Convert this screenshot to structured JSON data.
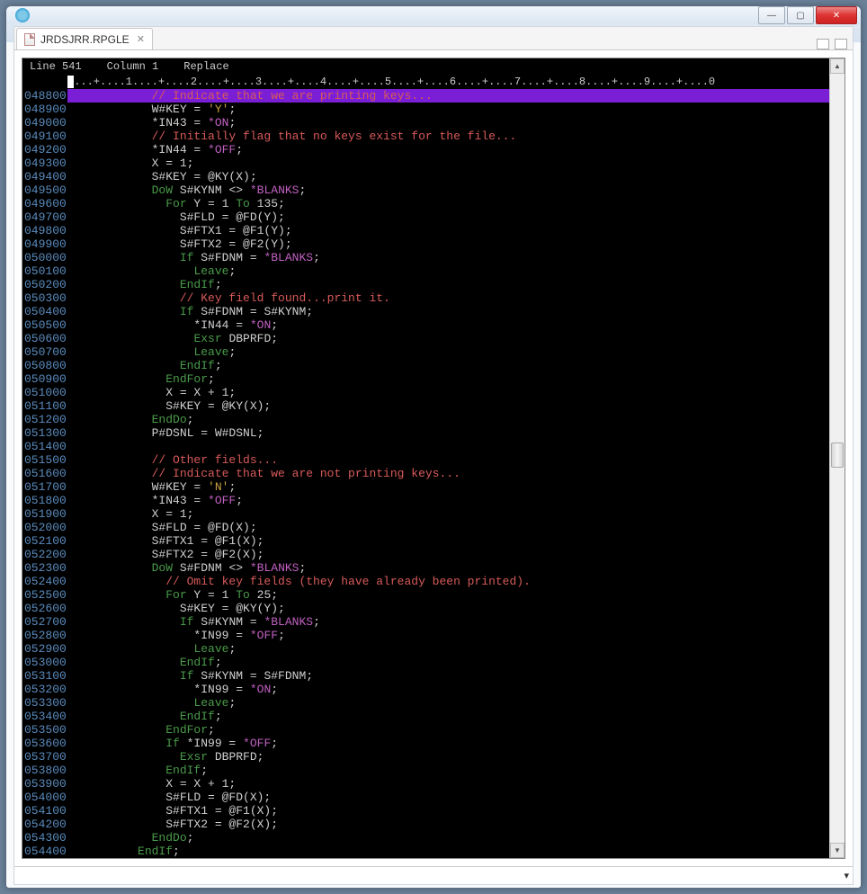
{
  "window": {
    "title": ""
  },
  "tab": {
    "filename": "JRDSJRR.RPGLE"
  },
  "status": {
    "line_label": "Line",
    "line": "541",
    "col_label": "Column",
    "col": "1",
    "mode": "Replace"
  },
  "ruler": "....+....1....+....2....+....3....+....4....+....5....+....6....+....7....+....8....+....9....+....0",
  "lines": [
    {
      "n": "048800",
      "seg": [
        {
          "c": "c-comment",
          "t": "            // Indicate that we are printing keys..."
        }
      ],
      "hl": true
    },
    {
      "n": "048900",
      "seg": [
        {
          "c": "c-plain",
          "t": "            W#KEY = "
        },
        {
          "c": "c-str",
          "t": "'Y'"
        },
        {
          "c": "c-plain",
          "t": ";"
        }
      ]
    },
    {
      "n": "049000",
      "seg": [
        {
          "c": "c-plain",
          "t": "            *IN43 = "
        },
        {
          "c": "c-special",
          "t": "*ON"
        },
        {
          "c": "c-plain",
          "t": ";"
        }
      ]
    },
    {
      "n": "049100",
      "seg": [
        {
          "c": "c-comment",
          "t": "            // Initially flag that no keys exist for the file..."
        }
      ]
    },
    {
      "n": "049200",
      "seg": [
        {
          "c": "c-plain",
          "t": "            *IN44 = "
        },
        {
          "c": "c-special",
          "t": "*OFF"
        },
        {
          "c": "c-plain",
          "t": ";"
        }
      ]
    },
    {
      "n": "049300",
      "seg": [
        {
          "c": "c-plain",
          "t": "            X = 1;"
        }
      ]
    },
    {
      "n": "049400",
      "seg": [
        {
          "c": "c-plain",
          "t": "            S#KEY = @KY(X);"
        }
      ]
    },
    {
      "n": "049500",
      "seg": [
        {
          "c": "c-plain",
          "t": "            "
        },
        {
          "c": "c-kw",
          "t": "DoW"
        },
        {
          "c": "c-plain",
          "t": " S#KYNM <> "
        },
        {
          "c": "c-special",
          "t": "*BLANKS"
        },
        {
          "c": "c-plain",
          "t": ";"
        }
      ]
    },
    {
      "n": "049600",
      "seg": [
        {
          "c": "c-plain",
          "t": "              "
        },
        {
          "c": "c-kw",
          "t": "For"
        },
        {
          "c": "c-plain",
          "t": " Y = 1 "
        },
        {
          "c": "c-kw",
          "t": "To"
        },
        {
          "c": "c-plain",
          "t": " 135;"
        }
      ]
    },
    {
      "n": "049700",
      "seg": [
        {
          "c": "c-plain",
          "t": "                S#FLD = @FD(Y);"
        }
      ]
    },
    {
      "n": "049800",
      "seg": [
        {
          "c": "c-plain",
          "t": "                S#FTX1 = @F1(Y);"
        }
      ]
    },
    {
      "n": "049900",
      "seg": [
        {
          "c": "c-plain",
          "t": "                S#FTX2 = @F2(Y);"
        }
      ]
    },
    {
      "n": "050000",
      "seg": [
        {
          "c": "c-plain",
          "t": "                "
        },
        {
          "c": "c-kw",
          "t": "If"
        },
        {
          "c": "c-plain",
          "t": " S#FDNM = "
        },
        {
          "c": "c-special",
          "t": "*BLANKS"
        },
        {
          "c": "c-plain",
          "t": ";"
        }
      ]
    },
    {
      "n": "050100",
      "seg": [
        {
          "c": "c-plain",
          "t": "                  "
        },
        {
          "c": "c-kw",
          "t": "Leave"
        },
        {
          "c": "c-plain",
          "t": ";"
        }
      ]
    },
    {
      "n": "050200",
      "seg": [
        {
          "c": "c-plain",
          "t": "                "
        },
        {
          "c": "c-kw",
          "t": "EndIf"
        },
        {
          "c": "c-plain",
          "t": ";"
        }
      ]
    },
    {
      "n": "050300",
      "seg": [
        {
          "c": "c-comment",
          "t": "                // Key field found...print it."
        }
      ]
    },
    {
      "n": "050400",
      "seg": [
        {
          "c": "c-plain",
          "t": "                "
        },
        {
          "c": "c-kw",
          "t": "If"
        },
        {
          "c": "c-plain",
          "t": " S#FDNM = S#KYNM;"
        }
      ]
    },
    {
      "n": "050500",
      "seg": [
        {
          "c": "c-plain",
          "t": "                  *IN44 = "
        },
        {
          "c": "c-special",
          "t": "*ON"
        },
        {
          "c": "c-plain",
          "t": ";"
        }
      ]
    },
    {
      "n": "050600",
      "seg": [
        {
          "c": "c-plain",
          "t": "                  "
        },
        {
          "c": "c-kw",
          "t": "Exsr"
        },
        {
          "c": "c-plain",
          "t": " DBPRFD;"
        }
      ]
    },
    {
      "n": "050700",
      "seg": [
        {
          "c": "c-plain",
          "t": "                  "
        },
        {
          "c": "c-kw",
          "t": "Leave"
        },
        {
          "c": "c-plain",
          "t": ";"
        }
      ]
    },
    {
      "n": "050800",
      "seg": [
        {
          "c": "c-plain",
          "t": "                "
        },
        {
          "c": "c-kw",
          "t": "EndIf"
        },
        {
          "c": "c-plain",
          "t": ";"
        }
      ]
    },
    {
      "n": "050900",
      "seg": [
        {
          "c": "c-plain",
          "t": "              "
        },
        {
          "c": "c-kw",
          "t": "EndFor"
        },
        {
          "c": "c-plain",
          "t": ";"
        }
      ]
    },
    {
      "n": "051000",
      "seg": [
        {
          "c": "c-plain",
          "t": "              X = X + 1;"
        }
      ]
    },
    {
      "n": "051100",
      "seg": [
        {
          "c": "c-plain",
          "t": "              S#KEY = @KY(X);"
        }
      ]
    },
    {
      "n": "051200",
      "seg": [
        {
          "c": "c-plain",
          "t": "            "
        },
        {
          "c": "c-kw",
          "t": "EndDo"
        },
        {
          "c": "c-plain",
          "t": ";"
        }
      ]
    },
    {
      "n": "051300",
      "seg": [
        {
          "c": "c-plain",
          "t": "            P#DSNL = W#DSNL;"
        }
      ]
    },
    {
      "n": "051400",
      "seg": [
        {
          "c": "c-plain",
          "t": ""
        }
      ]
    },
    {
      "n": "051500",
      "seg": [
        {
          "c": "c-comment",
          "t": "            // Other fields..."
        }
      ]
    },
    {
      "n": "051600",
      "seg": [
        {
          "c": "c-comment",
          "t": "            // Indicate that we are not printing keys..."
        }
      ]
    },
    {
      "n": "051700",
      "seg": [
        {
          "c": "c-plain",
          "t": "            W#KEY = "
        },
        {
          "c": "c-str",
          "t": "'N'"
        },
        {
          "c": "c-plain",
          "t": ";"
        }
      ]
    },
    {
      "n": "051800",
      "seg": [
        {
          "c": "c-plain",
          "t": "            *IN43 = "
        },
        {
          "c": "c-special",
          "t": "*OFF"
        },
        {
          "c": "c-plain",
          "t": ";"
        }
      ]
    },
    {
      "n": "051900",
      "seg": [
        {
          "c": "c-plain",
          "t": "            X = 1;"
        }
      ]
    },
    {
      "n": "052000",
      "seg": [
        {
          "c": "c-plain",
          "t": "            S#FLD = @FD(X);"
        }
      ]
    },
    {
      "n": "052100",
      "seg": [
        {
          "c": "c-plain",
          "t": "            S#FTX1 = @F1(X);"
        }
      ]
    },
    {
      "n": "052200",
      "seg": [
        {
          "c": "c-plain",
          "t": "            S#FTX2 = @F2(X);"
        }
      ]
    },
    {
      "n": "052300",
      "seg": [
        {
          "c": "c-plain",
          "t": "            "
        },
        {
          "c": "c-kw",
          "t": "DoW"
        },
        {
          "c": "c-plain",
          "t": " S#FDNM <> "
        },
        {
          "c": "c-special",
          "t": "*BLANKS"
        },
        {
          "c": "c-plain",
          "t": ";"
        }
      ]
    },
    {
      "n": "052400",
      "seg": [
        {
          "c": "c-comment",
          "t": "              // Omit key fields (they have already been printed)."
        }
      ]
    },
    {
      "n": "052500",
      "seg": [
        {
          "c": "c-plain",
          "t": "              "
        },
        {
          "c": "c-kw",
          "t": "For"
        },
        {
          "c": "c-plain",
          "t": " Y = 1 "
        },
        {
          "c": "c-kw",
          "t": "To"
        },
        {
          "c": "c-plain",
          "t": " 25;"
        }
      ]
    },
    {
      "n": "052600",
      "seg": [
        {
          "c": "c-plain",
          "t": "                S#KEY = @KY(Y);"
        }
      ]
    },
    {
      "n": "052700",
      "seg": [
        {
          "c": "c-plain",
          "t": "                "
        },
        {
          "c": "c-kw",
          "t": "If"
        },
        {
          "c": "c-plain",
          "t": " S#KYNM = "
        },
        {
          "c": "c-special",
          "t": "*BLANKS"
        },
        {
          "c": "c-plain",
          "t": ";"
        }
      ]
    },
    {
      "n": "052800",
      "seg": [
        {
          "c": "c-plain",
          "t": "                  *IN99 = "
        },
        {
          "c": "c-special",
          "t": "*OFF"
        },
        {
          "c": "c-plain",
          "t": ";"
        }
      ]
    },
    {
      "n": "052900",
      "seg": [
        {
          "c": "c-plain",
          "t": "                  "
        },
        {
          "c": "c-kw",
          "t": "Leave"
        },
        {
          "c": "c-plain",
          "t": ";"
        }
      ]
    },
    {
      "n": "053000",
      "seg": [
        {
          "c": "c-plain",
          "t": "                "
        },
        {
          "c": "c-kw",
          "t": "EndIf"
        },
        {
          "c": "c-plain",
          "t": ";"
        }
      ]
    },
    {
      "n": "053100",
      "seg": [
        {
          "c": "c-plain",
          "t": "                "
        },
        {
          "c": "c-kw",
          "t": "If"
        },
        {
          "c": "c-plain",
          "t": " S#KYNM = S#FDNM;"
        }
      ]
    },
    {
      "n": "053200",
      "seg": [
        {
          "c": "c-plain",
          "t": "                  *IN99 = "
        },
        {
          "c": "c-special",
          "t": "*ON"
        },
        {
          "c": "c-plain",
          "t": ";"
        }
      ]
    },
    {
      "n": "053300",
      "seg": [
        {
          "c": "c-plain",
          "t": "                  "
        },
        {
          "c": "c-kw",
          "t": "Leave"
        },
        {
          "c": "c-plain",
          "t": ";"
        }
      ]
    },
    {
      "n": "053400",
      "seg": [
        {
          "c": "c-plain",
          "t": "                "
        },
        {
          "c": "c-kw",
          "t": "EndIf"
        },
        {
          "c": "c-plain",
          "t": ";"
        }
      ]
    },
    {
      "n": "053500",
      "seg": [
        {
          "c": "c-plain",
          "t": "              "
        },
        {
          "c": "c-kw",
          "t": "EndFor"
        },
        {
          "c": "c-plain",
          "t": ";"
        }
      ]
    },
    {
      "n": "053600",
      "seg": [
        {
          "c": "c-plain",
          "t": "              "
        },
        {
          "c": "c-kw",
          "t": "If"
        },
        {
          "c": "c-plain",
          "t": " *IN99 = "
        },
        {
          "c": "c-special",
          "t": "*OFF"
        },
        {
          "c": "c-plain",
          "t": ";"
        }
      ]
    },
    {
      "n": "053700",
      "seg": [
        {
          "c": "c-plain",
          "t": "                "
        },
        {
          "c": "c-kw",
          "t": "Exsr"
        },
        {
          "c": "c-plain",
          "t": " DBPRFD;"
        }
      ]
    },
    {
      "n": "053800",
      "seg": [
        {
          "c": "c-plain",
          "t": "              "
        },
        {
          "c": "c-kw",
          "t": "EndIf"
        },
        {
          "c": "c-plain",
          "t": ";"
        }
      ]
    },
    {
      "n": "053900",
      "seg": [
        {
          "c": "c-plain",
          "t": "              X = X + 1;"
        }
      ]
    },
    {
      "n": "054000",
      "seg": [
        {
          "c": "c-plain",
          "t": "              S#FLD = @FD(X);"
        }
      ]
    },
    {
      "n": "054100",
      "seg": [
        {
          "c": "c-plain",
          "t": "              S#FTX1 = @F1(X);"
        }
      ]
    },
    {
      "n": "054200",
      "seg": [
        {
          "c": "c-plain",
          "t": "              S#FTX2 = @F2(X);"
        }
      ]
    },
    {
      "n": "054300",
      "seg": [
        {
          "c": "c-plain",
          "t": "            "
        },
        {
          "c": "c-kw",
          "t": "EndDo"
        },
        {
          "c": "c-plain",
          "t": ";"
        }
      ]
    },
    {
      "n": "054400",
      "seg": [
        {
          "c": "c-plain",
          "t": "          "
        },
        {
          "c": "c-kw",
          "t": "EndIf"
        },
        {
          "c": "c-plain",
          "t": ";"
        }
      ]
    }
  ]
}
